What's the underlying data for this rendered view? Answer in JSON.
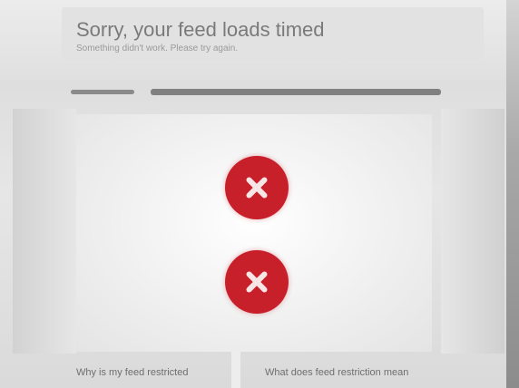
{
  "header": {
    "title": "Sorry, your feed loads timed",
    "subtitle": "Something didn't work. Please try again."
  },
  "statuses": [
    {
      "icon": "error-x-circle-icon",
      "color": "#c8202a"
    },
    {
      "icon": "error-x-circle-icon",
      "color": "#c8202a"
    }
  ],
  "footer": {
    "left_link": "Why is my feed restricted",
    "right_link": "What does feed restriction mean"
  },
  "colors": {
    "error": "#c8202a",
    "background": "#dcdcdc",
    "panel": "#f4f4f4"
  }
}
